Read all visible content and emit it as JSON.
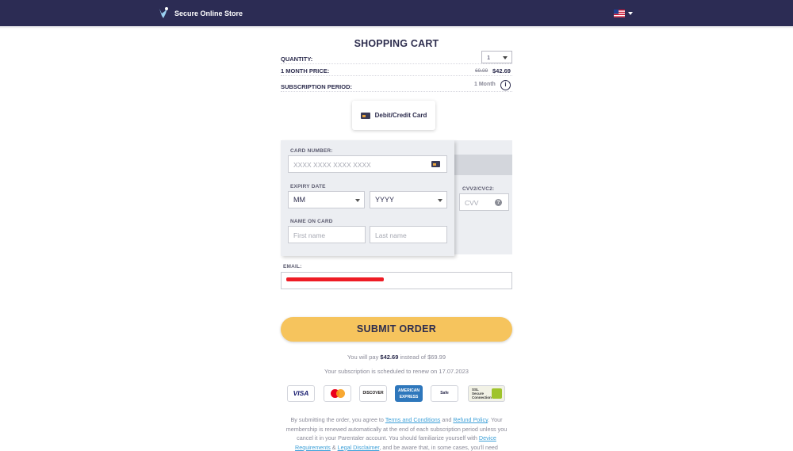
{
  "header": {
    "brand_name": "Secure Online Store",
    "logo_icon": "hand-heart-logo-icon",
    "language_flag": "us-flag-icon"
  },
  "cart": {
    "title": "SHOPPING CART",
    "quantity_label": "QUANTITY:",
    "quantity_value": "1",
    "price_label": "1 MONTH PRICE:",
    "price_old": "69.99",
    "price_new": "$42.69",
    "period_label": "SUBSCRIPTION PERIOD:",
    "period_value": "1 Month"
  },
  "payment_method": {
    "label": "Debit/Credit Card"
  },
  "card_form": {
    "card_number_label": "CARD NUMBER:",
    "card_number_placeholder": "XXXX XXXX XXXX XXXX",
    "expiry_label": "EXPIRY DATE",
    "expiry_month": "MM",
    "expiry_year": "YYYY",
    "cvv_label": "CVV2/CVC2:",
    "cvv_placeholder": "CVV",
    "name_label": "NAME ON CARD",
    "first_name_placeholder": "First name",
    "last_name_placeholder": "Last name"
  },
  "email": {
    "label": "EMAIL:",
    "redacted": true
  },
  "submit": {
    "label": "SUBMIT ORDER"
  },
  "summary": {
    "pay_prefix": "You will pay",
    "pay_amount": "$42.69",
    "pay_suffix": "instead of $69.99",
    "renew_text": "Your subscription is scheduled to renew on 17.07.2023"
  },
  "badges": {
    "visa": "VISA",
    "discover": "DISCOVER",
    "amex_line1": "AMERICAN",
    "amex_line2": "EXPRESS",
    "safe": "Safe",
    "ssl_line1": "SSL",
    "ssl_line2": "Secure",
    "ssl_line3": "Connection"
  },
  "legal": {
    "t1": "By submitting the order, you agree to",
    "terms_link": "Terms and Conditions",
    "t2": "and",
    "refund_link": "Refund Policy",
    "t3": ". Your membership is renewed automatically at the end of each subscription period unless you cancel it in your Parentaler account. You should familiarize yourself with",
    "device_link": "Device Requirements",
    "t4": "&",
    "disclaimer_link": "Legal Disclaimer",
    "t5": ", and be aware that, in some cases, you'll need"
  }
}
